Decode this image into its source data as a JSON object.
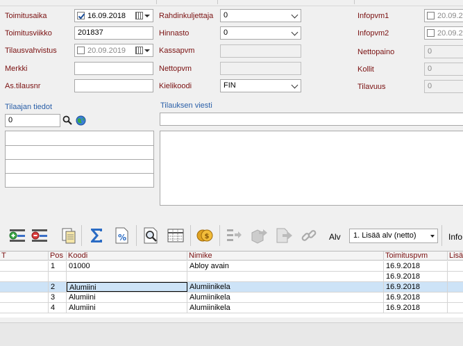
{
  "form": {
    "toimitusaika": {
      "label": "Toimitusaika",
      "value": "16.09.2018",
      "checked": true
    },
    "toimitusviikko": {
      "label": "Toimitusviikko",
      "value": "201837"
    },
    "tilausvahvistus": {
      "label": "Tilausvahvistus",
      "value": "20.09.2019",
      "checked": false
    },
    "merkki": {
      "label": "Merkki",
      "value": ""
    },
    "as_tilausnr": {
      "label": "As.tilausnr",
      "value": ""
    },
    "rahdinkuljettaja": {
      "label": "Rahdinkuljettaja",
      "value": "0"
    },
    "hinnasto": {
      "label": "Hinnasto",
      "value": "0"
    },
    "kassapvm": {
      "label": "Kassapvm",
      "value": ""
    },
    "nettopvm": {
      "label": "Nettopvm",
      "value": ""
    },
    "kielikoodi": {
      "label": "Kielikoodi",
      "value": "FIN"
    },
    "infopvm1": {
      "label": "Infopvm1",
      "value": "20.09.20"
    },
    "infopvm2": {
      "label": "Infopvm2",
      "value": "20.09.20"
    },
    "nettopaino": {
      "label": "Nettopaino",
      "value": "0"
    },
    "kollit": {
      "label": "Kollit",
      "value": "0"
    },
    "tilavuus": {
      "label": "Tilavuus",
      "value": "0"
    }
  },
  "tilaajan_tiedot": {
    "label": "Tilaajan tiedot",
    "search_value": "0"
  },
  "tilauksen_viesti": {
    "label": "Tilauksen viesti",
    "value": ""
  },
  "toolbar": {
    "alv_label": "Alv",
    "alv_select": "1. Lisää alv (netto)",
    "info_label": "Info"
  },
  "grid": {
    "columns": [
      "T",
      "Pos",
      "Koodi",
      "Nimike",
      "Toimituspvm",
      "Lisä"
    ],
    "rows": [
      {
        "pos": "1",
        "koodi": "01000",
        "nimike": "Abloy avain",
        "pvm": "16.9.2018"
      },
      {
        "pos": "",
        "koodi": "",
        "nimike": "",
        "pvm": "16.9.2018"
      },
      {
        "pos": "2",
        "koodi": "Alumiini",
        "nimike": "Alumiinikela",
        "pvm": "16.9.2018"
      },
      {
        "pos": "3",
        "koodi": "Alumiini",
        "nimike": "Alumiinikela",
        "pvm": "16.9.2018"
      },
      {
        "pos": "4",
        "koodi": "Alumiini",
        "nimike": "Alumiinikela",
        "pvm": "16.9.2018"
      }
    ]
  },
  "colors": {
    "label": "#7a1010",
    "section": "#2a5fa8",
    "selected_row": "#cde3f7"
  }
}
